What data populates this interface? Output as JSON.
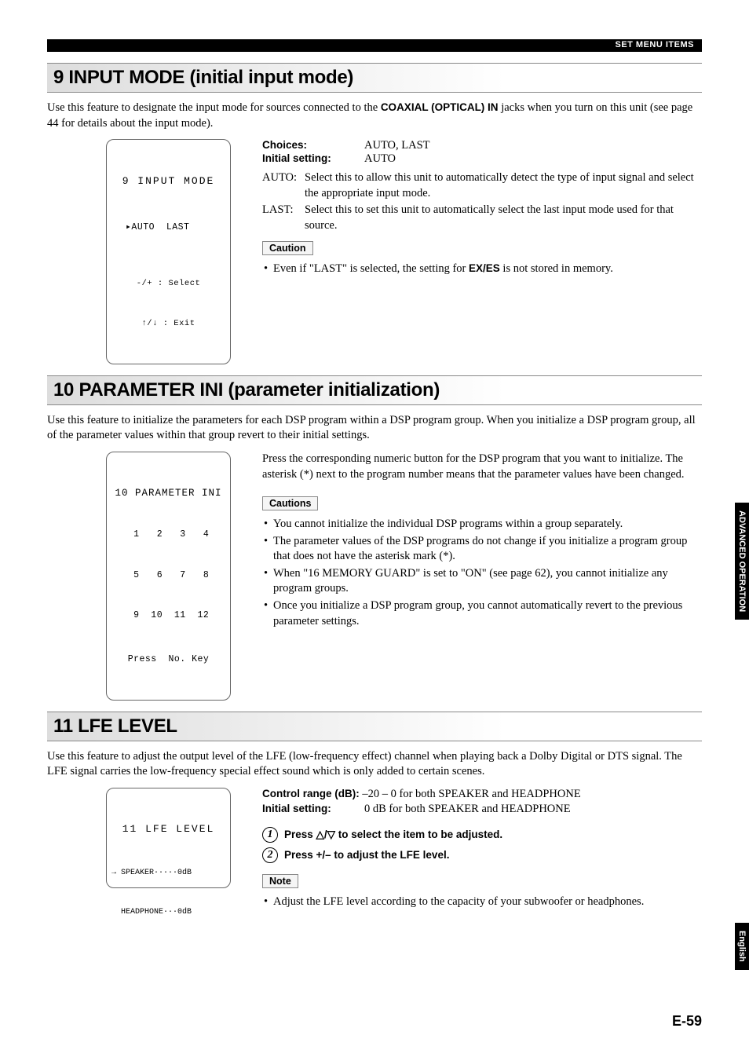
{
  "header": {
    "section_label": "SET MENU ITEMS"
  },
  "sec9": {
    "title": "9 INPUT MODE (initial input mode)",
    "intro_pre": "Use this feature to designate the input mode for sources connected to the ",
    "intro_bold": "COAXIAL (OPTICAL) IN",
    "intro_post": " jacks when you turn on this unit (see page 44 for details about the input mode).",
    "lcd": {
      "l1": "9 INPUT MODE",
      "l2": "▸AUTO  LAST",
      "l3": "-/+ : Select",
      "l4": "↑/↓ : Exit"
    },
    "choices_label": "Choices:",
    "choices_val": "AUTO, LAST",
    "initial_label": "Initial setting:",
    "initial_val": "AUTO",
    "opts": [
      {
        "k": "AUTO:",
        "v": "Select this to allow this unit to automatically detect the type of input signal and select the appropriate input mode."
      },
      {
        "k": "LAST:",
        "v": "Select this to set this unit to automatically select the last input mode used for that source."
      }
    ],
    "caution_label": "Caution",
    "caution_pre": "Even if \"LAST\" is selected, the setting for ",
    "caution_bold": "EX/ES",
    "caution_post": " is not stored in memory."
  },
  "sec10": {
    "title": "10 PARAMETER INI (parameter initialization)",
    "intro": "Use this feature to initialize the parameters for each DSP program within a DSP program group. When you initialize a DSP program group, all of the parameter values within that group revert to their initial settings.",
    "lcd": {
      "l1": "10 PARAMETER INI",
      "l2": " 1   2   3   4",
      "l3": " 5   6   7   8",
      "l4": " 9  10  11  12",
      "l5": "Press  No. Key"
    },
    "right_para": "Press the corresponding numeric button for the DSP program that you want to initialize. The asterisk (*) next to the program number means that the parameter values have been changed.",
    "cautions_label": "Cautions",
    "cautions": [
      "You cannot initialize the individual DSP programs within a group separately.",
      "The parameter values of the DSP programs do not change if you initialize a program group that does not have the asterisk mark (*).",
      "When \"16 MEMORY GUARD\" is set to \"ON\" (see page 62), you cannot initialize any program groups.",
      "Once you initialize a DSP program group, you cannot automatically revert to the previous parameter settings."
    ]
  },
  "sec11": {
    "title": "11 LFE LEVEL",
    "intro": "Use this feature to adjust the output level of the LFE (low-frequency effect) channel when playing back a Dolby Digital or DTS signal. The LFE signal carries the low-frequency special effect sound which is only added to certain scenes.",
    "lcd": {
      "l1": "11 LFE LEVEL",
      "l2": "→ SPEAKER·····0dB",
      "l3": "  HEADPHONE···0dB"
    },
    "range_label": "Control range (dB):",
    "range_val": " –20 – 0 for both SPEAKER and HEADPHONE",
    "initial_label": "Initial setting:",
    "initial_val": "0 dB for both SPEAKER and HEADPHONE",
    "step1": "Press △/▽ to select the item to be adjusted.",
    "step2": "Press +/– to adjust the LFE level.",
    "note_label": "Note",
    "note": "Adjust the LFE level according to the capacity of your subwoofer or headphones."
  },
  "sidebar": {
    "adv": "ADVANCED\nOPERATION",
    "eng": "English"
  },
  "footer": {
    "prefix": "E-",
    "num": "59"
  }
}
